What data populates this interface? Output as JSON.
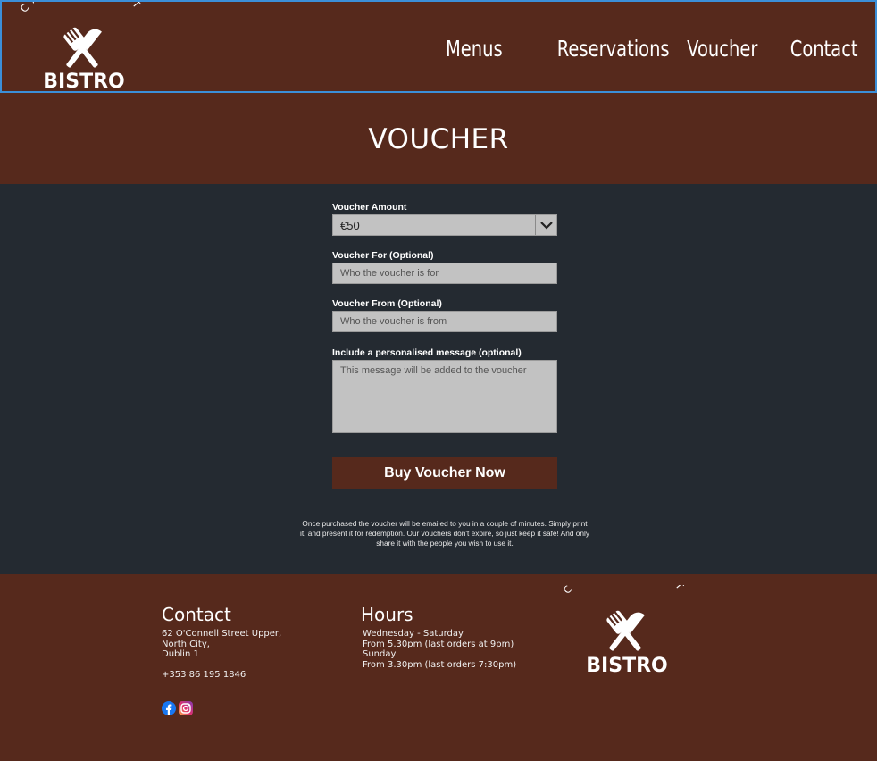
{
  "header": {
    "logo_top_text": "CANDLELIGHT",
    "logo_bottom_text": "BISTRO",
    "nav": [
      "Menus",
      "Reservations",
      "Voucher",
      "Contact"
    ]
  },
  "page": {
    "title": "VOUCHER"
  },
  "form": {
    "amount_label": "Voucher Amount",
    "amount_value": "€50",
    "for_label": "Voucher For (Optional)",
    "for_placeholder": "Who the voucher is for",
    "from_label": "Voucher From (Optional)",
    "from_placeholder": "Who the voucher is from",
    "message_label": "Include a personalised message (optional)",
    "message_placeholder": "This message will be added to the voucher",
    "submit_label": "Buy Voucher Now",
    "note": "Once purchased the voucher will be emailed to you in a couple of minutes. Simply print it, and present it for redemption. Our vouchers don't expire, so just keep it safe! And only share it with the people you wish to use it."
  },
  "footer": {
    "contact_heading": "Contact",
    "address_line1": "62 O'Connell Street Upper,",
    "address_line2": "North City,",
    "address_line3": "Dublin 1",
    "phone": "+353 86 195 1846",
    "hours_heading": "Hours",
    "hours_line1": "Wednesday - Saturday",
    "hours_line2": "From 5.30pm (last orders at 9pm)",
    "hours_line3": "Sunday",
    "hours_line4": "From 3.30pm (last orders 7:30pm)",
    "social_icons": [
      "facebook-icon",
      "instagram-icon"
    ]
  },
  "colors": {
    "brand_brown": "#56291c",
    "body_dark": "#242a31",
    "input_grey": "#c2c2c2",
    "header_outline": "#3b8fd8"
  }
}
